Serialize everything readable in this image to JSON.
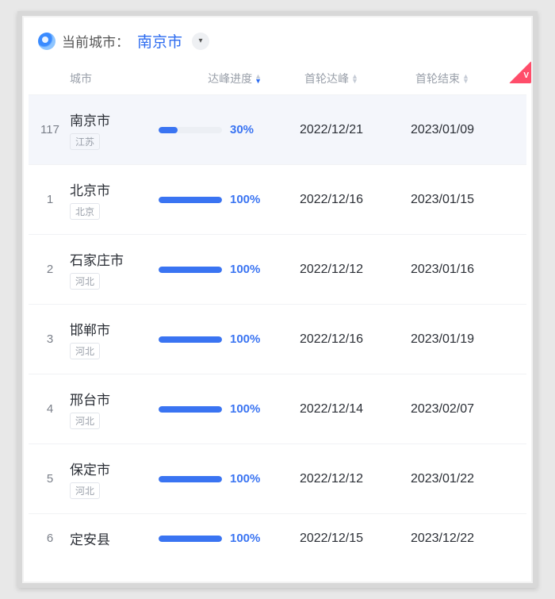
{
  "header": {
    "label": "当前城市：",
    "selected_city": "南京市"
  },
  "columns": {
    "city": "城市",
    "progress": "达峰进度",
    "peak": "首轮达峰",
    "end": "首轮结束"
  },
  "rows": [
    {
      "rank": "117",
      "city": "南京市",
      "province": "江苏",
      "progress": 30,
      "peak": "2022/12/21",
      "end": "2023/01/09",
      "highlight": true
    },
    {
      "rank": "1",
      "city": "北京市",
      "province": "北京",
      "progress": 100,
      "peak": "2022/12/16",
      "end": "2023/01/15"
    },
    {
      "rank": "2",
      "city": "石家庄市",
      "province": "河北",
      "progress": 100,
      "peak": "2022/12/12",
      "end": "2023/01/16"
    },
    {
      "rank": "3",
      "city": "邯郸市",
      "province": "河北",
      "progress": 100,
      "peak": "2022/12/16",
      "end": "2023/01/19"
    },
    {
      "rank": "4",
      "city": "邢台市",
      "province": "河北",
      "progress": 100,
      "peak": "2022/12/14",
      "end": "2023/02/07"
    },
    {
      "rank": "5",
      "city": "保定市",
      "province": "河北",
      "progress": 100,
      "peak": "2022/12/12",
      "end": "2023/01/22"
    },
    {
      "rank": "6",
      "city": "定安县",
      "province": "",
      "progress": 100,
      "peak": "2022/12/15",
      "end": "2023/12/22"
    }
  ]
}
